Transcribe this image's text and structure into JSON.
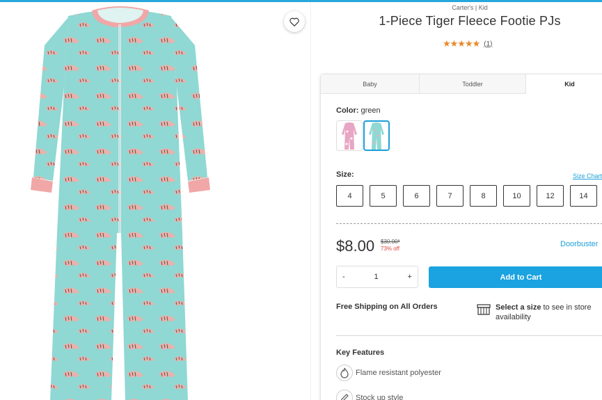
{
  "product": {
    "brand_line": "Carter's | Kid",
    "title": "1-Piece Tiger Fleece Footie PJs",
    "stars": "★★★★★",
    "review_count": "(1)"
  },
  "tabs": [
    "Baby",
    "Toddler",
    "Kid"
  ],
  "selected_tab": "Kid",
  "color": {
    "label": "Color:",
    "value": "green"
  },
  "size": {
    "label": "Size:",
    "chart_link": "Size Chart",
    "options": [
      "4",
      "5",
      "6",
      "7",
      "8",
      "10",
      "12",
      "14"
    ]
  },
  "pricing": {
    "price": "$8.00",
    "original": "$30.00*",
    "discount": "73% off",
    "badge": "Doorbuster"
  },
  "quantity": {
    "minus": "-",
    "value": "1",
    "plus": "+"
  },
  "cart": {
    "add_label": "Add to Cart"
  },
  "shipping": {
    "free_label": "Free Shipping on All Orders",
    "store_bold": "Select a size",
    "store_rest": " to see in store availability"
  },
  "features": {
    "title": "Key Features",
    "items": [
      "Flame resistant polyester",
      "Stock up style"
    ]
  },
  "colors": {
    "accent": "#1aa3e0",
    "star": "#e8892b",
    "discount": "#e0413a",
    "pajama_base": "#8fd8d4",
    "pajama_trim": "#f1a7a7"
  }
}
